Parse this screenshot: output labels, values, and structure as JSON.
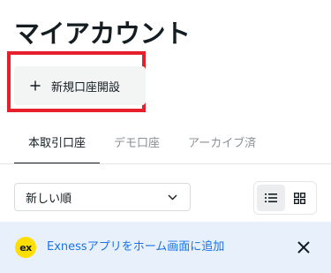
{
  "header": {
    "title": "マイアカウント"
  },
  "actions": {
    "new_account_label": "新規口座開設"
  },
  "tabs": [
    {
      "label": "本取引口座",
      "active": true
    },
    {
      "label": "デモ口座",
      "active": false
    },
    {
      "label": "アーカイブ済",
      "active": false
    }
  ],
  "sort": {
    "selected": "新しい順"
  },
  "view_toggle": {
    "active": "list"
  },
  "banner": {
    "logo_text": "ex",
    "link_text": "Exnessアプリをホーム画面に追加"
  },
  "colors": {
    "highlight": "#e3202b",
    "link": "#1a73e8",
    "logo_bg": "#ffde02",
    "banner_bg": "#e8f0fb"
  }
}
